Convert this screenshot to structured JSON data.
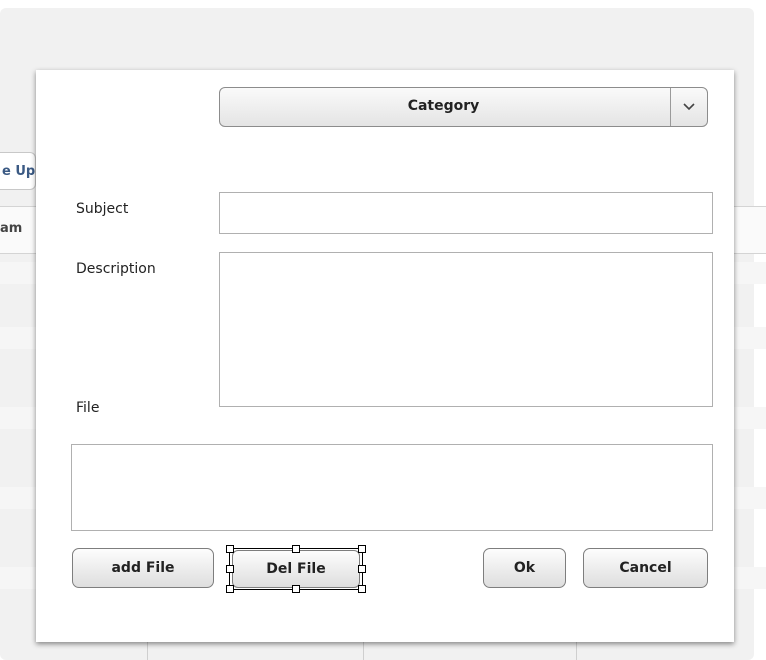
{
  "background": {
    "tab_label": "e Up",
    "header_label": "am"
  },
  "dialog": {
    "category": {
      "label": "Category",
      "arrow_icon": "chevron-down-icon"
    },
    "subject": {
      "label": "Subject",
      "value": ""
    },
    "description": {
      "label": "Description",
      "value": ""
    },
    "file": {
      "label": "File"
    },
    "buttons": {
      "add_file": "add File",
      "del_file": "Del File",
      "ok": "Ok",
      "cancel": "Cancel"
    }
  }
}
